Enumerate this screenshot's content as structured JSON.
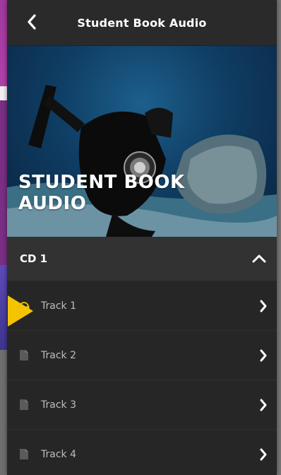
{
  "header": {
    "title": "Student Book Audio",
    "back_icon": "chevron-left-icon"
  },
  "hero": {
    "title": "STUDENT BOOK AUDIO"
  },
  "section": {
    "title": "CD 1",
    "toggle_icon": "chevron-up-icon"
  },
  "tracks": [
    {
      "label": "Track 1",
      "icon": "headphones-icon"
    },
    {
      "label": "Track 2",
      "icon": "document-icon"
    },
    {
      "label": "Track 3",
      "icon": "document-icon"
    },
    {
      "label": "Track 4",
      "icon": "document-icon"
    }
  ],
  "colors": {
    "accent_yellow": "#f5c400",
    "header_bg": "#2a2a2a",
    "list_bg": "#262626",
    "section_bg": "#323232"
  }
}
